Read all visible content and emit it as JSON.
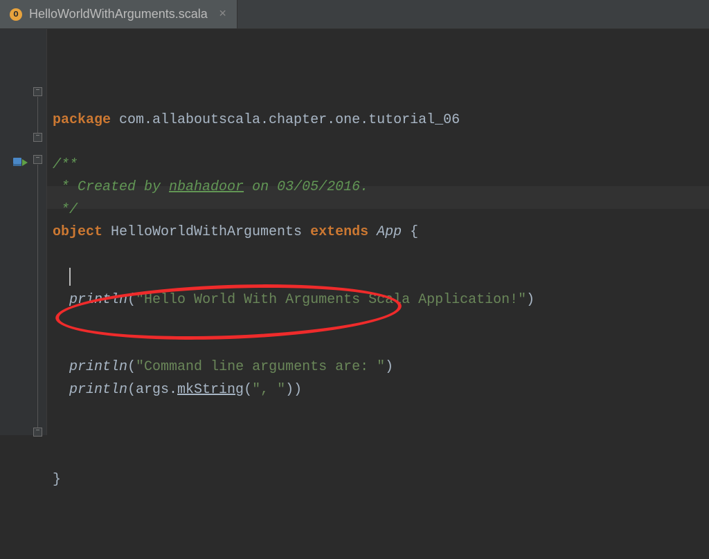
{
  "tab": {
    "filename": "HelloWorldWithArguments.scala",
    "icon_letter": "O"
  },
  "code": {
    "line1_kw": "package",
    "line1_pkg": " com.allaboutscala.chapter.one.tutorial_06",
    "doc_open": "/**",
    "doc_created_prefix": " * Created by ",
    "doc_author": "nbahadoor",
    "doc_created_suffix": " on 03/05/2016.",
    "doc_close": " */",
    "obj_kw": "object",
    "obj_name": " HelloWorldWithArguments ",
    "extends_kw": "extends",
    "app_ref": " App ",
    "brace_open": "{",
    "println1_fn": "println",
    "println1_open": "(",
    "println1_str": "\"Hello World With Arguments Scala Application!\"",
    "println1_close": ")",
    "println2_fn": "println",
    "println2_open": "(",
    "println2_str": "\"Command line arguments are: \"",
    "println2_close": ")",
    "println3_fn": "println",
    "println3_open": "(args.",
    "println3_mk": "mkString",
    "println3_after": "(",
    "println3_str": "\", \"",
    "println3_close": "))",
    "brace_close": "}"
  }
}
